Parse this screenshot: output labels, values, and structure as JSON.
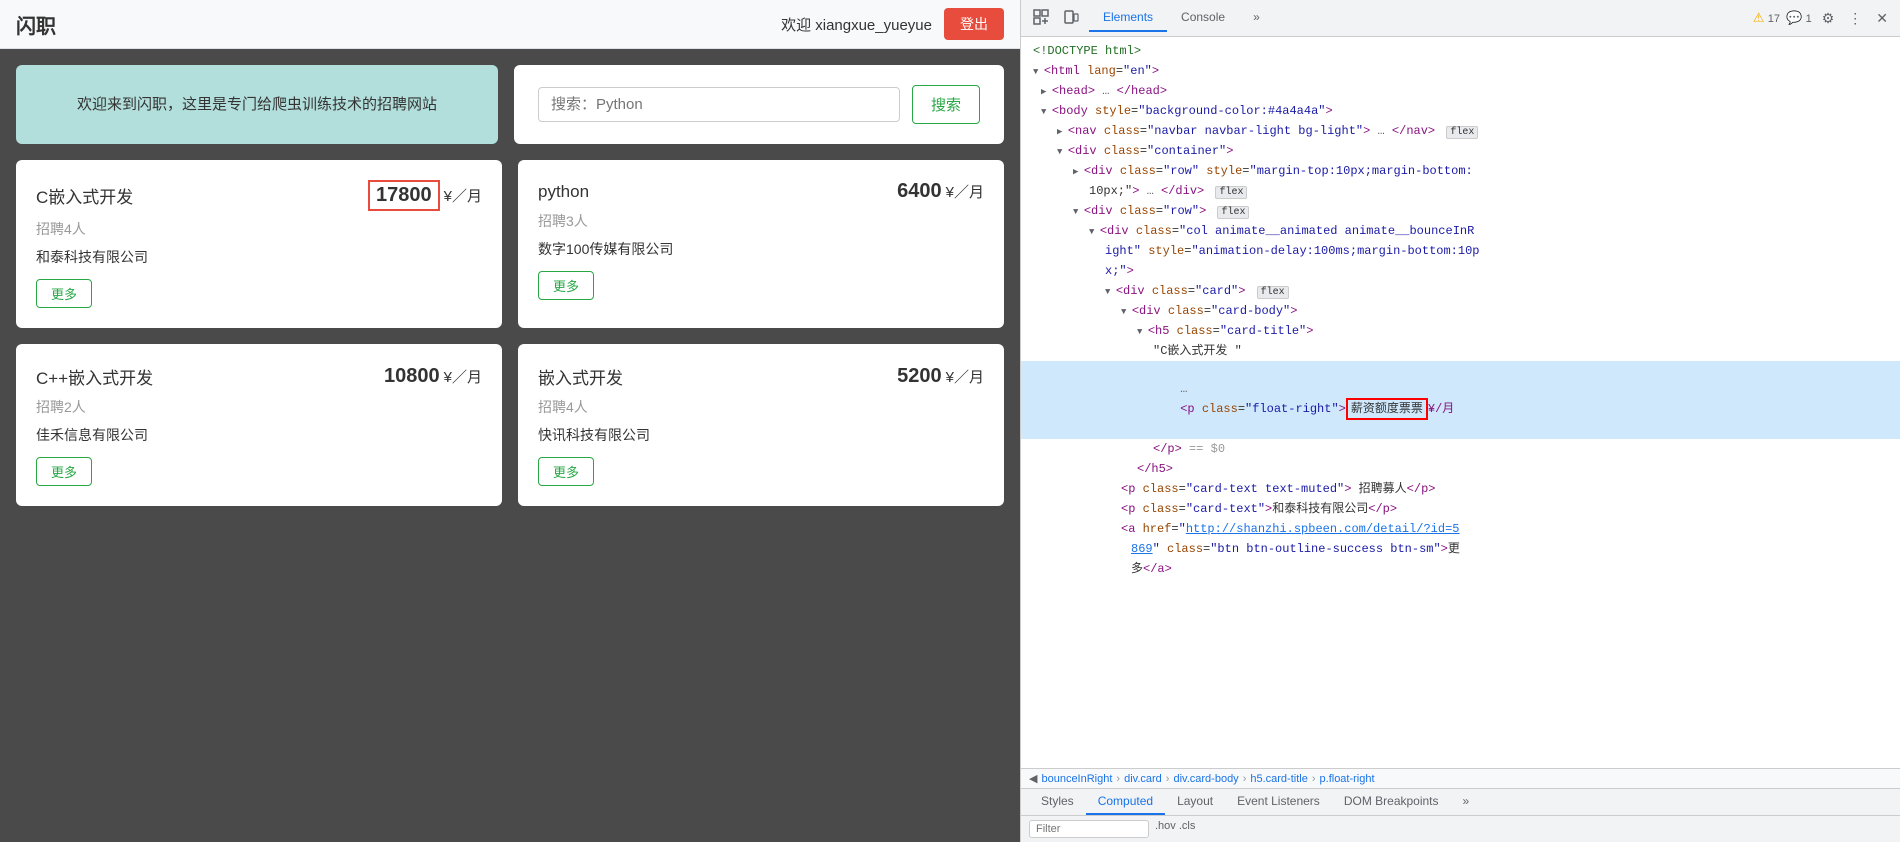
{
  "app": {
    "brand": "闪职",
    "welcome": "欢迎 xiangxue_yueyue",
    "logout_label": "登出"
  },
  "banner": {
    "text": "欢迎来到闪职，这里是专门给爬虫训练技术的招聘网站"
  },
  "search": {
    "placeholder": "搜索：Python",
    "button": "搜索"
  },
  "cards": [
    {
      "title": "C嵌入式开发",
      "salary": "17800",
      "salary_unit": "¥／月",
      "hire": "招聘4人",
      "company": "和泰科技有限公司",
      "btn": "更多",
      "highlighted": true
    },
    {
      "title": "python",
      "salary": "6400",
      "salary_unit": "¥／月",
      "hire": "招聘3人",
      "company": "数字100传媒有限公司",
      "btn": "更多",
      "highlighted": false
    },
    {
      "title": "C++嵌入式开发",
      "salary": "10800",
      "salary_unit": "¥／月",
      "hire": "招聘2人",
      "company": "佳禾信息有限公司",
      "btn": "更多",
      "highlighted": false
    },
    {
      "title": "嵌入式开发",
      "salary": "5200",
      "salary_unit": "¥／月",
      "hire": "招聘4人",
      "company": "快讯科技有限公司",
      "btn": "更多",
      "highlighted": false
    }
  ],
  "devtools": {
    "tabs": [
      "Elements",
      "Console",
      "»"
    ],
    "active_tab": "Elements",
    "warning_count": "17",
    "message_count": "1",
    "bottom_tabs": [
      "Styles",
      "Computed",
      "Layout",
      "Event Listeners",
      "DOM Breakpoints",
      "»"
    ],
    "active_bottom_tab": "Computed",
    "filter_placeholder": "Filter",
    "breadcrumb": [
      "bounceInRight",
      "div.card",
      "div.card-body",
      "h5.card-title",
      "p.float-right"
    ]
  }
}
